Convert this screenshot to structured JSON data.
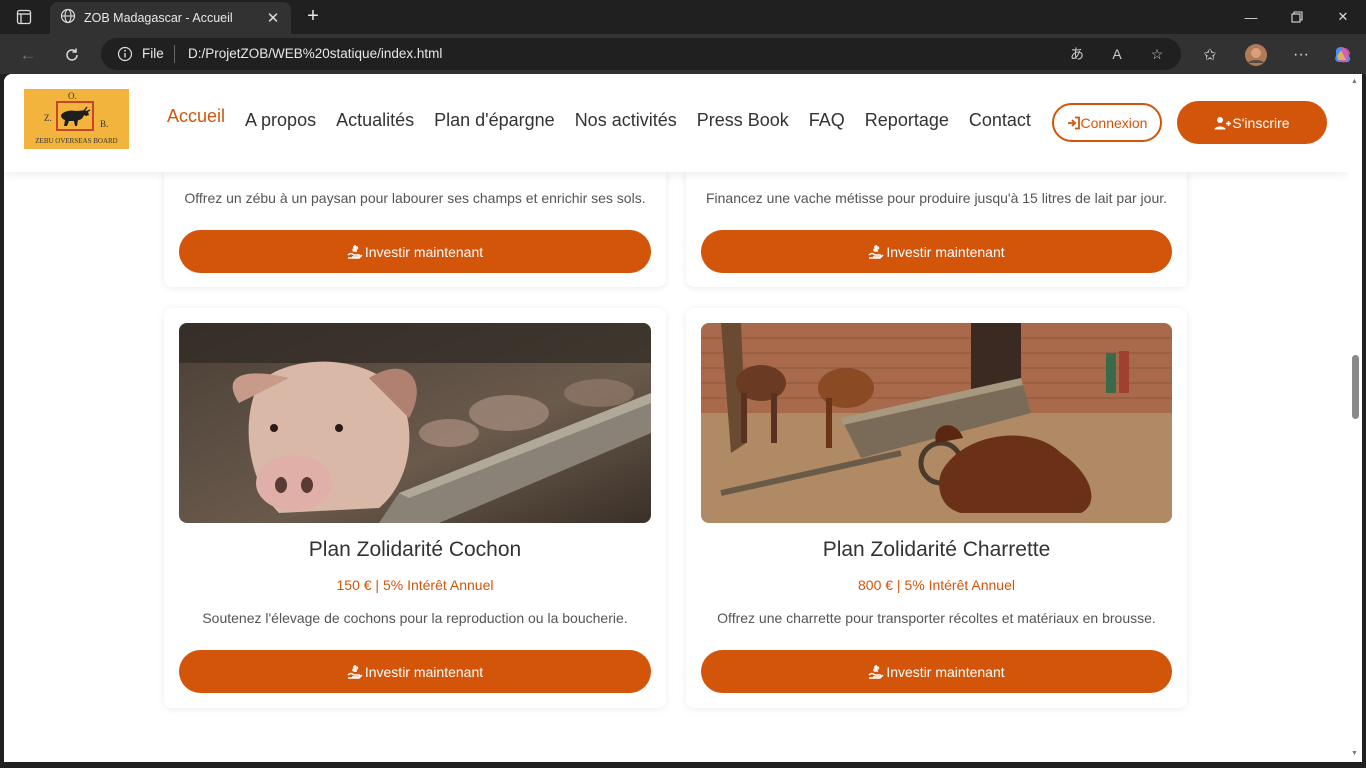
{
  "browser": {
    "tab_title": "ZOB Madagascar - Accueil",
    "url_scheme": "File",
    "url": "D:/ProjetZOB/WEB%20statique/index.html"
  },
  "site": {
    "logo_letters": {
      "z": "Z.",
      "b": "B.",
      "o": "O."
    },
    "logo_caption": "ZEBU OVERSEAS BOARD",
    "nav": [
      "Accueil",
      "A propos",
      "Actualités",
      "Plan d'épargne",
      "Nos activités",
      "Press Book",
      "FAQ",
      "Reportage",
      "Contact"
    ],
    "active_nav": "Accueil",
    "login": "Connexion",
    "signup": "S'inscrire"
  },
  "cards": [
    {
      "desc": "Offrez un zébu à un paysan pour labourer ses champs et enrichir ses sols.",
      "button": "Investir maintenant"
    },
    {
      "desc": "Financez une vache métisse pour produire jusqu'à 15 litres de lait par jour.",
      "button": "Investir maintenant"
    },
    {
      "title": "Plan Zolidarité Cochon",
      "price": "150 € | 5% Intérêt Annuel",
      "desc": "Soutenez l'élevage de cochons pour la reproduction ou la boucherie.",
      "button": "Investir maintenant"
    },
    {
      "title": "Plan Zolidarité Charrette",
      "price": "800 € | 5% Intérêt Annuel",
      "desc": "Offrez une charrette pour transporter récoltes et matériaux en brousse.",
      "button": "Investir maintenant"
    }
  ],
  "colors": {
    "accent": "#d2550a",
    "browser_dark": "#202020",
    "browser_mid": "#323232"
  }
}
